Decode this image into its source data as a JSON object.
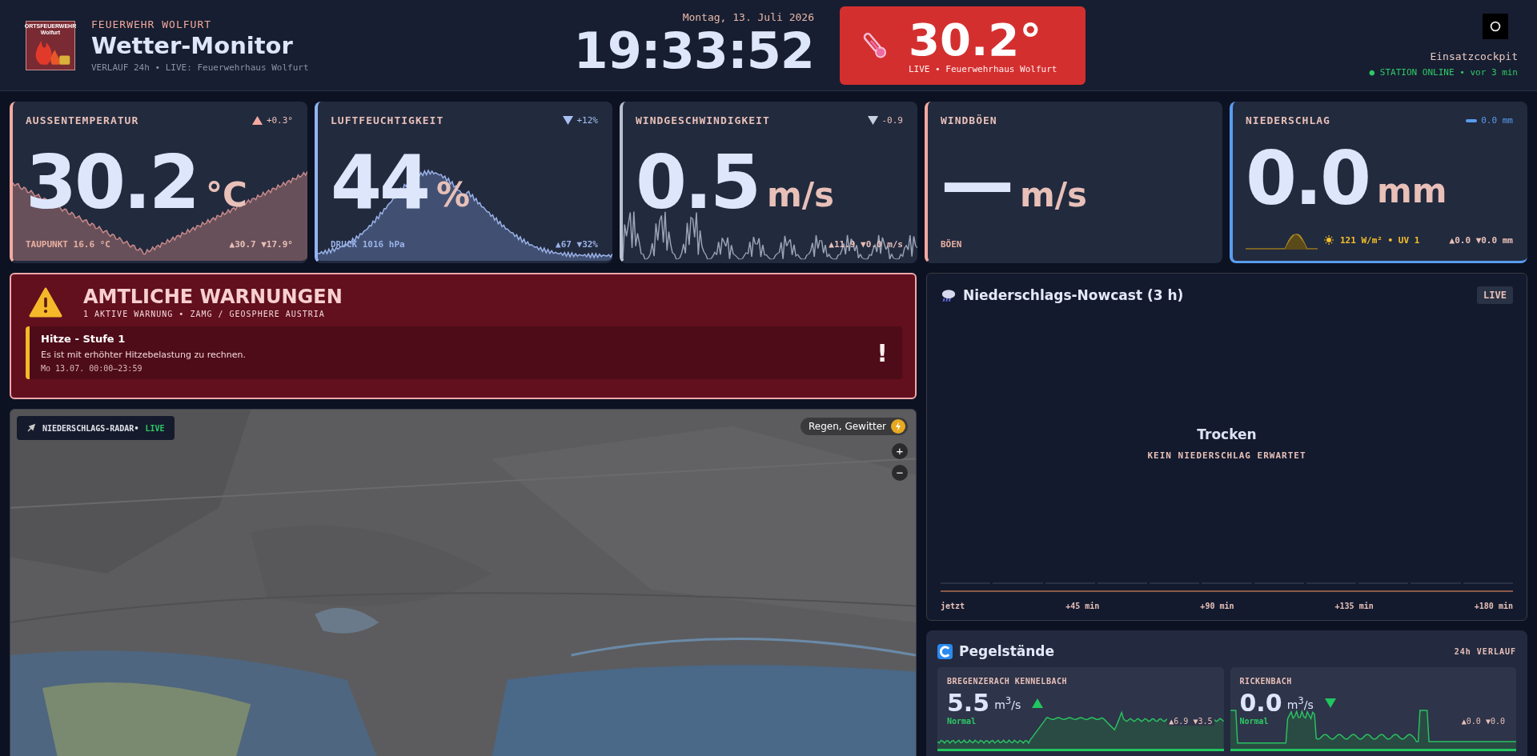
{
  "header": {
    "logo_text": [
      "ORTSFEUERWEHR",
      "Wolfurt"
    ],
    "org": "FEUERWEHR WOLFURT",
    "title": "Wetter-Monitor",
    "subtitle": "VERLAUF 24h • LIVE: Feuerwehrhaus Wolfurt",
    "date": "Montag, 13. Juli 2026",
    "time": "19:33:52",
    "live_temp": "30.2°",
    "live_caption": "LIVE • Feuerwehrhaus Wolfurt",
    "cockpit": "Einsatzcockpit",
    "status": "● STATION ONLINE • vor 3 min"
  },
  "cards": [
    {
      "label": "AUSSENTEMPERATUR",
      "trend": {
        "kind": "up",
        "delta": "+0.3°"
      },
      "value": "30.2",
      "unit": "°C",
      "footer_left": "TAUPUNKT 16.6 °C",
      "footer_right": "▲30.7 ▼17.9°",
      "color": "#f4aaa0"
    },
    {
      "label": "LUFTFEUCHTIGKEIT",
      "trend": {
        "kind": "down",
        "delta": "+12%"
      },
      "value": "44",
      "unit": "%",
      "footer_left": "DRUCK 1016 hPa",
      "footer_right": "▲67 ▼32%",
      "color": "#93b4f4"
    },
    {
      "label": "WINDGESCHWINDIGKEIT",
      "trend": {
        "kind": "down",
        "delta": "-0.9"
      },
      "value": "0.5",
      "unit": "m/s",
      "footer_right": "▲11.9 ▼0.0 m/s",
      "color": "#b8c0d0"
    },
    {
      "label": "WINDBÖEN",
      "value": "—",
      "unit": "m/s",
      "footer_left": "BÖEN",
      "color": "#f4aaa0"
    },
    {
      "label": "NIEDERSCHLAG",
      "trend": {
        "kind": "flat",
        "delta": "0.0 mm"
      },
      "value": "0.0",
      "unit": "mm",
      "footer_left": "121 W/m² • UV 1",
      "footer_right": "▲0.0 ▼0.0 mm",
      "color": "#5a9cf0"
    }
  ],
  "warnings": {
    "title": "AMTLICHE WARNUNGEN",
    "subtitle": "1 AKTIVE WARNUNG • ZAMG / GEOSPHERE AUSTRIA",
    "items": [
      {
        "title": "Hitze - Stufe 1",
        "text": "Es ist mit erhöhter Hitzebelastung zu rechnen.",
        "time": "Mo 13.07. 00:00–23:59",
        "mark": "!",
        "color": "#f5b82a"
      }
    ]
  },
  "radar": {
    "label": "NIEDERSCHLAGS-RADAR•",
    "live": "LIVE",
    "layer": "Regen, Gewitter",
    "zoom_in": "+",
    "zoom_out": "−"
  },
  "nowcast": {
    "title": "Niederschlags-Nowcast (3 h)",
    "badge": "LIVE",
    "state": "Trocken",
    "note": "KEIN NIEDERSCHLAG ERWARTET",
    "axis": [
      "jetzt",
      "+45 min",
      "+90 min",
      "+135 min",
      "+180 min"
    ]
  },
  "gauges": {
    "title": "Pegelstände",
    "badge": "24h VERLAUF",
    "items": [
      {
        "name": "BREGENZERACH KENNELBACH",
        "value": "5.5",
        "unit": "m$^{3}$/s",
        "trend": {
          "kind": "up"
        },
        "status": "Normal",
        "range": "▲6.9 ▼3.5"
      },
      {
        "name": "RICKENBACH",
        "value": "0.0",
        "unit": "m$^{3}$/s",
        "trend": {
          "kind": "down"
        },
        "status": "Normal",
        "range": "▲0.0 ▼0.0"
      }
    ]
  }
}
